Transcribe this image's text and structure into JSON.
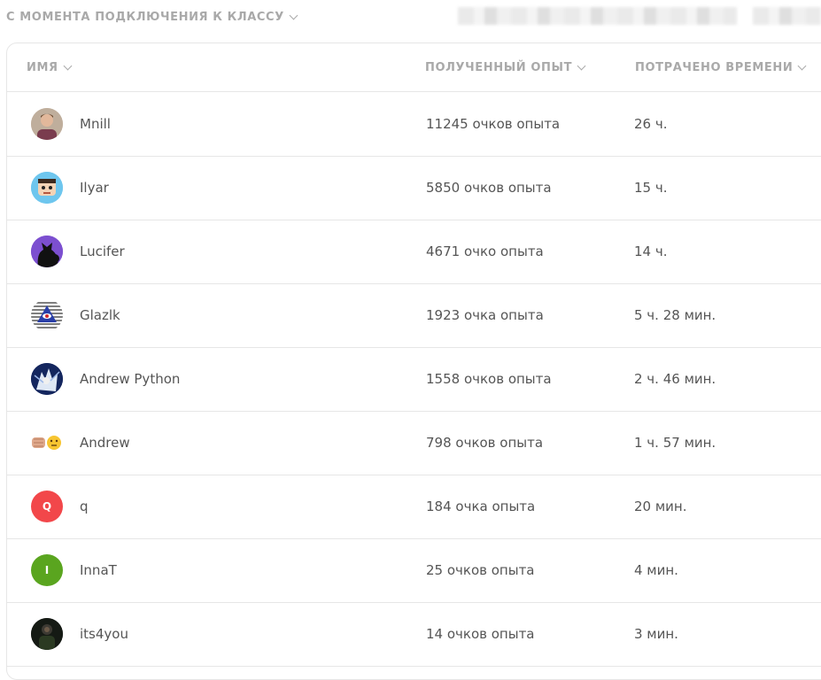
{
  "filter": {
    "label": "С МОМЕНТА ПОДКЛЮЧЕНИЯ К КЛАССУ"
  },
  "columns": {
    "name": "ИМЯ",
    "xp": "ПОЛУЧЕННЫЙ ОПЫТ",
    "time": "ПОТРАЧЕНО ВРЕМЕНИ"
  },
  "rows": [
    {
      "name": "Mnill",
      "xp": "11245 очков опыта",
      "time": "26 ч.",
      "avatar": "photo-person"
    },
    {
      "name": "Ilyar",
      "xp": "5850 очков опыта",
      "time": "15 ч.",
      "avatar": "cartoon-face"
    },
    {
      "name": "Lucifer",
      "xp": "4671 очко опыта",
      "time": "14 ч.",
      "avatar": "black-cat"
    },
    {
      "name": "Glazlk",
      "xp": "1923 очка опыта",
      "time": "5 ч. 28 мин.",
      "avatar": "eye-triangle"
    },
    {
      "name": "Andrew Python",
      "xp": "1558 очков опыта",
      "time": "2 ч. 46 мин.",
      "avatar": "anime"
    },
    {
      "name": "Andrew",
      "xp": "798 очков опыта",
      "time": "1 ч. 57 мин.",
      "avatar": "emoji"
    },
    {
      "name": "q",
      "xp": "184 очка опыта",
      "time": "20 мин.",
      "avatar": "letter",
      "letter": "Q",
      "color": "#f2474a"
    },
    {
      "name": "InnaT",
      "xp": "25 очков опыта",
      "time": "4 мин.",
      "avatar": "letter",
      "letter": "I",
      "color": "#5aa51f"
    },
    {
      "name": "its4you",
      "xp": "14 очков опыта",
      "time": "3 мин.",
      "avatar": "photo-dark"
    }
  ]
}
